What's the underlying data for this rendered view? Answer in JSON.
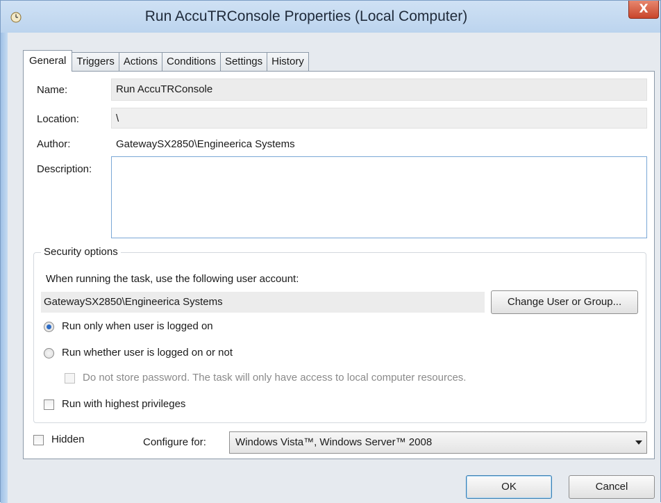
{
  "window": {
    "title": "Run AccuTRConsole Properties (Local Computer)",
    "close_glyph": "X"
  },
  "tabs": [
    "General",
    "Triggers",
    "Actions",
    "Conditions",
    "Settings",
    "History"
  ],
  "general": {
    "name_label": "Name:",
    "name_value": "Run AccuTRConsole",
    "location_label": "Location:",
    "location_value": "\\",
    "author_label": "Author:",
    "author_value": "GatewaySX2850\\Engineerica Systems",
    "description_label": "Description:",
    "description_value": ""
  },
  "security": {
    "group_title": "Security options",
    "account_prompt": "When running the task, use the following user account:",
    "account_value": "GatewaySX2850\\Engineerica Systems",
    "change_button": "Change User or Group...",
    "radio_logged_on": "Run only when user is logged on",
    "radio_whether": "Run whether user is logged on or not",
    "no_store_password": "Do not store password.  The task will only have access to local computer resources.",
    "highest_privileges": "Run with highest privileges",
    "selected_radio": "logged_on"
  },
  "bottom": {
    "hidden_label": "Hidden",
    "configure_label": "Configure for:",
    "configure_value": "Windows Vista™, Windows Server™ 2008"
  },
  "buttons": {
    "ok": "OK",
    "cancel": "Cancel"
  },
  "colors": {
    "titlebar": "#bcd4ee",
    "close_button": "#c9452b",
    "radio_selected": "#2c6bc4"
  }
}
